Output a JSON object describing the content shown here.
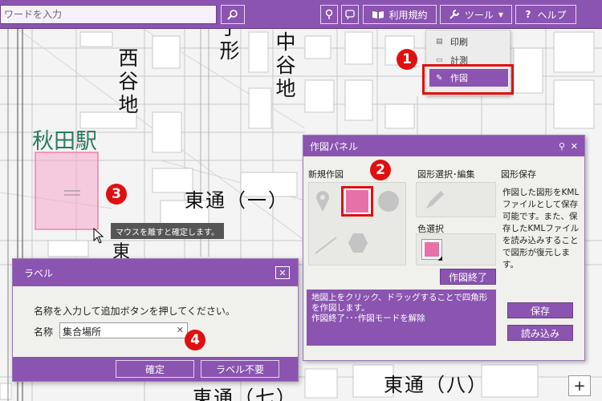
{
  "search": {
    "placeholder": "ワードを入力"
  },
  "toolbar": {
    "terms_label": "利用規約",
    "tools_label": "ツール",
    "help_label": "ヘルプ"
  },
  "tool_menu": {
    "items": [
      {
        "label": "印刷",
        "icon": "print-icon"
      },
      {
        "label": "計測",
        "icon": "ruler-icon"
      },
      {
        "label": "作図",
        "icon": "pencil-icon"
      }
    ]
  },
  "map": {
    "labels": {
      "nishi_yachi": "西谷地",
      "naka_yachi": "中谷地",
      "kata": "子形",
      "akita_station": "秋田駅",
      "higashi_dori_1": "東通（一）",
      "higashi_dori_8": "東通（八）",
      "higashi_dori_7": "東通（七）",
      "higashi_partial": "東"
    }
  },
  "callouts": [
    "1",
    "2",
    "3",
    "4"
  ],
  "draw_panel": {
    "title": "作図パネル",
    "new_shape_title": "新規作図",
    "select_edit_title": "図形選択･編集",
    "save_title": "図形保存",
    "color_select_title": "色選択",
    "finish_label": "作図終了",
    "save_description": "作図した図形をKMLファイルとして保存可能です。また、保存したKMLファイルを読み込みすることで図形が復元します。",
    "instructions": "地図上をクリック、ドラッグすることで四角形を作図します。\n作図終了･･･作図モードを解除",
    "save_button": "保存",
    "load_button": "読み込み",
    "selected_color": "#e870a8"
  },
  "tooltip": {
    "text": "マウスを離すと確定します。"
  },
  "label_dialog": {
    "title": "ラベル",
    "instruction": "名称を入力して追加ボタンを押してください。",
    "name_label": "名称",
    "name_value": "集合場所",
    "confirm_button": "確定",
    "no_label_button": "ラベル不要"
  },
  "zoom": {
    "plus": "+"
  },
  "colors": {
    "accent": "#8a54b0",
    "callout": "#e01010",
    "drawn_rect": "#f4a8c8"
  }
}
